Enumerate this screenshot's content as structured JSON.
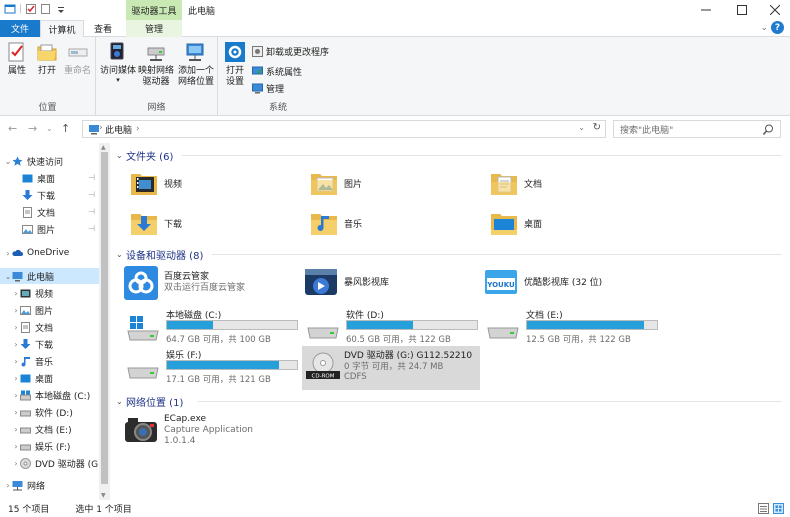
{
  "title": "此电脑",
  "context_tab": "驱动器工具",
  "tabs": {
    "file": "文件",
    "computer": "计算机",
    "view": "查看",
    "manage": "管理"
  },
  "ribbon": {
    "groups": {
      "location": "位置",
      "network": "网络",
      "system": "系统"
    },
    "buttons": {
      "properties": "属性",
      "open": "打开",
      "rename": "重命名",
      "access_media": "访问媒体",
      "map_drive_1": "映射网络",
      "map_drive_2": "驱动器",
      "add_location_1": "添加一个",
      "add_location_2": "网络位置",
      "open_settings_1": "打开",
      "open_settings_2": "设置",
      "uninstall": "卸载或更改程序",
      "sys_props": "系统属性",
      "manage": "管理"
    }
  },
  "address": {
    "path": "此电脑",
    "search_placeholder": "搜索\"此电脑\""
  },
  "nav": {
    "quick_access": "快速访问",
    "quick_items": [
      "桌面",
      "下载",
      "文档",
      "图片"
    ],
    "onedrive": "OneDrive",
    "this_pc": "此电脑",
    "pc_items": [
      "视频",
      "图片",
      "文档",
      "下载",
      "音乐",
      "桌面",
      "本地磁盘 (C:)",
      "软件 (D:)",
      "文档 (E:)",
      "娱乐 (F:)",
      "DVD 驱动器 (G:"
    ],
    "network": "网络"
  },
  "sections": {
    "folders": "文件夹 (6)",
    "devices": "设备和驱动器 (8)",
    "netloc": "网络位置 (1)"
  },
  "folders": [
    "视频",
    "图片",
    "文档",
    "下载",
    "音乐",
    "桌面"
  ],
  "apps": {
    "baidu_name": "百度云管家",
    "baidu_sub": "双击运行百度云管家",
    "storm_name": "暴风影视库",
    "youku_name": "优酷影视库 (32 位)"
  },
  "drives": [
    {
      "name": "本地磁盘 (C:)",
      "info": "64.7 GB 可用，共 100 GB",
      "used": 0.353
    },
    {
      "name": "软件 (D:)",
      "info": "60.5 GB 可用，共 122 GB",
      "used": 0.504
    },
    {
      "name": "文档 (E:)",
      "info": "12.5 GB 可用，共 122 GB",
      "used": 0.898
    },
    {
      "name": "娱乐 (F:)",
      "info": "17.1 GB 可用，共 121 GB",
      "used": 0.859
    }
  ],
  "dvd": {
    "name": "DVD 驱动器 (G:) G112.52210",
    "info": "0 字节 可用，共 24.7 MB",
    "fs": "CDFS",
    "disc_label": "CD-ROM"
  },
  "ecap": {
    "name": "ECap.exe",
    "sub1": "Capture Application",
    "sub2": "1.0.1.4"
  },
  "status": {
    "count": "15 个项目",
    "selected": "选中 1 个项目"
  },
  "colors": {
    "accent": "#1979ca",
    "bar": "#26a0da",
    "context": "#c9e9b4",
    "section": "#1e3287"
  }
}
